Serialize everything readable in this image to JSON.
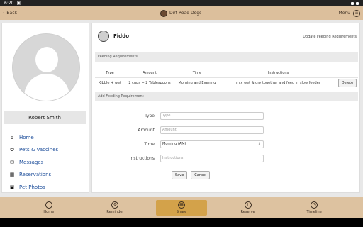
{
  "status_bar": {
    "time": "6:20"
  },
  "top_bar": {
    "back_label": "Back",
    "brand_title": "Dirt Road Dogs",
    "menu_label": "Menu"
  },
  "sidebar": {
    "user_name": "Robert Smith",
    "items": [
      {
        "label": "Home",
        "icon": "home-icon",
        "glyph": "⌂"
      },
      {
        "label": "Pets & Vaccines",
        "icon": "paw-icon",
        "glyph": "✿"
      },
      {
        "label": "Messages",
        "icon": "envelope-icon",
        "glyph": "✉"
      },
      {
        "label": "Reservations",
        "icon": "calendar-icon",
        "glyph": "▦"
      },
      {
        "label": "Pet Photos",
        "icon": "photo-icon",
        "glyph": "▣"
      }
    ]
  },
  "pet": {
    "name": "Fiddo",
    "update_link": "Update Feeding Requirements"
  },
  "feeding": {
    "section_title": "Feeding Requirements",
    "columns": [
      "Type",
      "Amount",
      "Time",
      "Instructions",
      ""
    ],
    "rows": [
      {
        "type": "Kibble + wet",
        "amount": "2 cups + 2 Tablespoons",
        "time": "Morning and Evening",
        "instructions": "mix wet & dry together and feed in slow feeder",
        "action": "Delete"
      }
    ]
  },
  "add_form": {
    "section_title": "Add Feeding Requirement",
    "type_label": "Type",
    "type_placeholder": "Type",
    "amount_label": "Amount",
    "amount_placeholder": "Amount",
    "time_label": "Time",
    "time_value": "Morning (AM)",
    "instructions_label": "Instructions",
    "instructions_placeholder": "Instructions",
    "save_label": "Save",
    "cancel_label": "Cancel"
  },
  "bottom_nav": {
    "tabs": [
      {
        "label": "Home",
        "icon": "home-icon"
      },
      {
        "label": "Reminder",
        "icon": "gear-icon"
      },
      {
        "label": "Share",
        "icon": "share-icon",
        "active": true
      },
      {
        "label": "Reserve",
        "icon": "plus-icon"
      },
      {
        "label": "Timeline",
        "icon": "timeline-icon"
      }
    ]
  },
  "colors": {
    "accent": "#d3a24a",
    "link": "#1c4d9a",
    "bar": "#dcbf9c"
  }
}
